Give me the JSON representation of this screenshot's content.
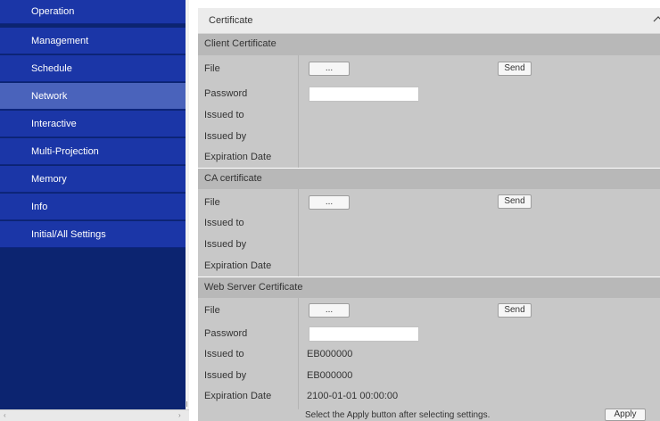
{
  "sidebar": {
    "items": [
      {
        "label": "Operation"
      },
      {
        "label": "Management"
      },
      {
        "label": "Schedule"
      },
      {
        "label": "Network"
      },
      {
        "label": "Interactive"
      },
      {
        "label": "Multi-Projection"
      },
      {
        "label": "Memory"
      },
      {
        "label": "Info"
      },
      {
        "label": "Initial/All Settings"
      }
    ],
    "active": "Network",
    "colors": {
      "item": "#1b36a7",
      "active": "#4a63bb",
      "background": "#0c2470"
    }
  },
  "panel": {
    "title": "Certificate",
    "collapse_icon": "chevron-up-icon"
  },
  "client_certificate": {
    "title": "Client Certificate",
    "file_label": "File",
    "browse_label": "...",
    "send_label": "Send",
    "password_label": "Password",
    "password_value": "",
    "issued_to_label": "Issued to",
    "issued_to_value": "",
    "issued_by_label": "Issued by",
    "issued_by_value": "",
    "expiration_label": "Expiration Date",
    "expiration_value": ""
  },
  "ca_certificate": {
    "title": "CA certificate",
    "file_label": "File",
    "browse_label": "...",
    "send_label": "Send",
    "issued_to_label": "Issued to",
    "issued_to_value": "",
    "issued_by_label": "Issued by",
    "issued_by_value": "",
    "expiration_label": "Expiration Date",
    "expiration_value": ""
  },
  "web_server_certificate": {
    "title": "Web Server Certificate",
    "file_label": "File",
    "browse_label": "...",
    "send_label": "Send",
    "password_label": "Password",
    "password_value": "",
    "issued_to_label": "Issued to",
    "issued_to_value": "EB000000",
    "issued_by_label": "Issued by",
    "issued_by_value": "EB000000",
    "expiration_label": "Expiration Date",
    "expiration_value": "2100-01-01 00:00:00"
  },
  "footer": {
    "hint": "Select the Apply button after selecting settings.",
    "apply_label": "Apply"
  },
  "scrollbar": {
    "left_arrow": "‹",
    "right_arrow": "›"
  }
}
